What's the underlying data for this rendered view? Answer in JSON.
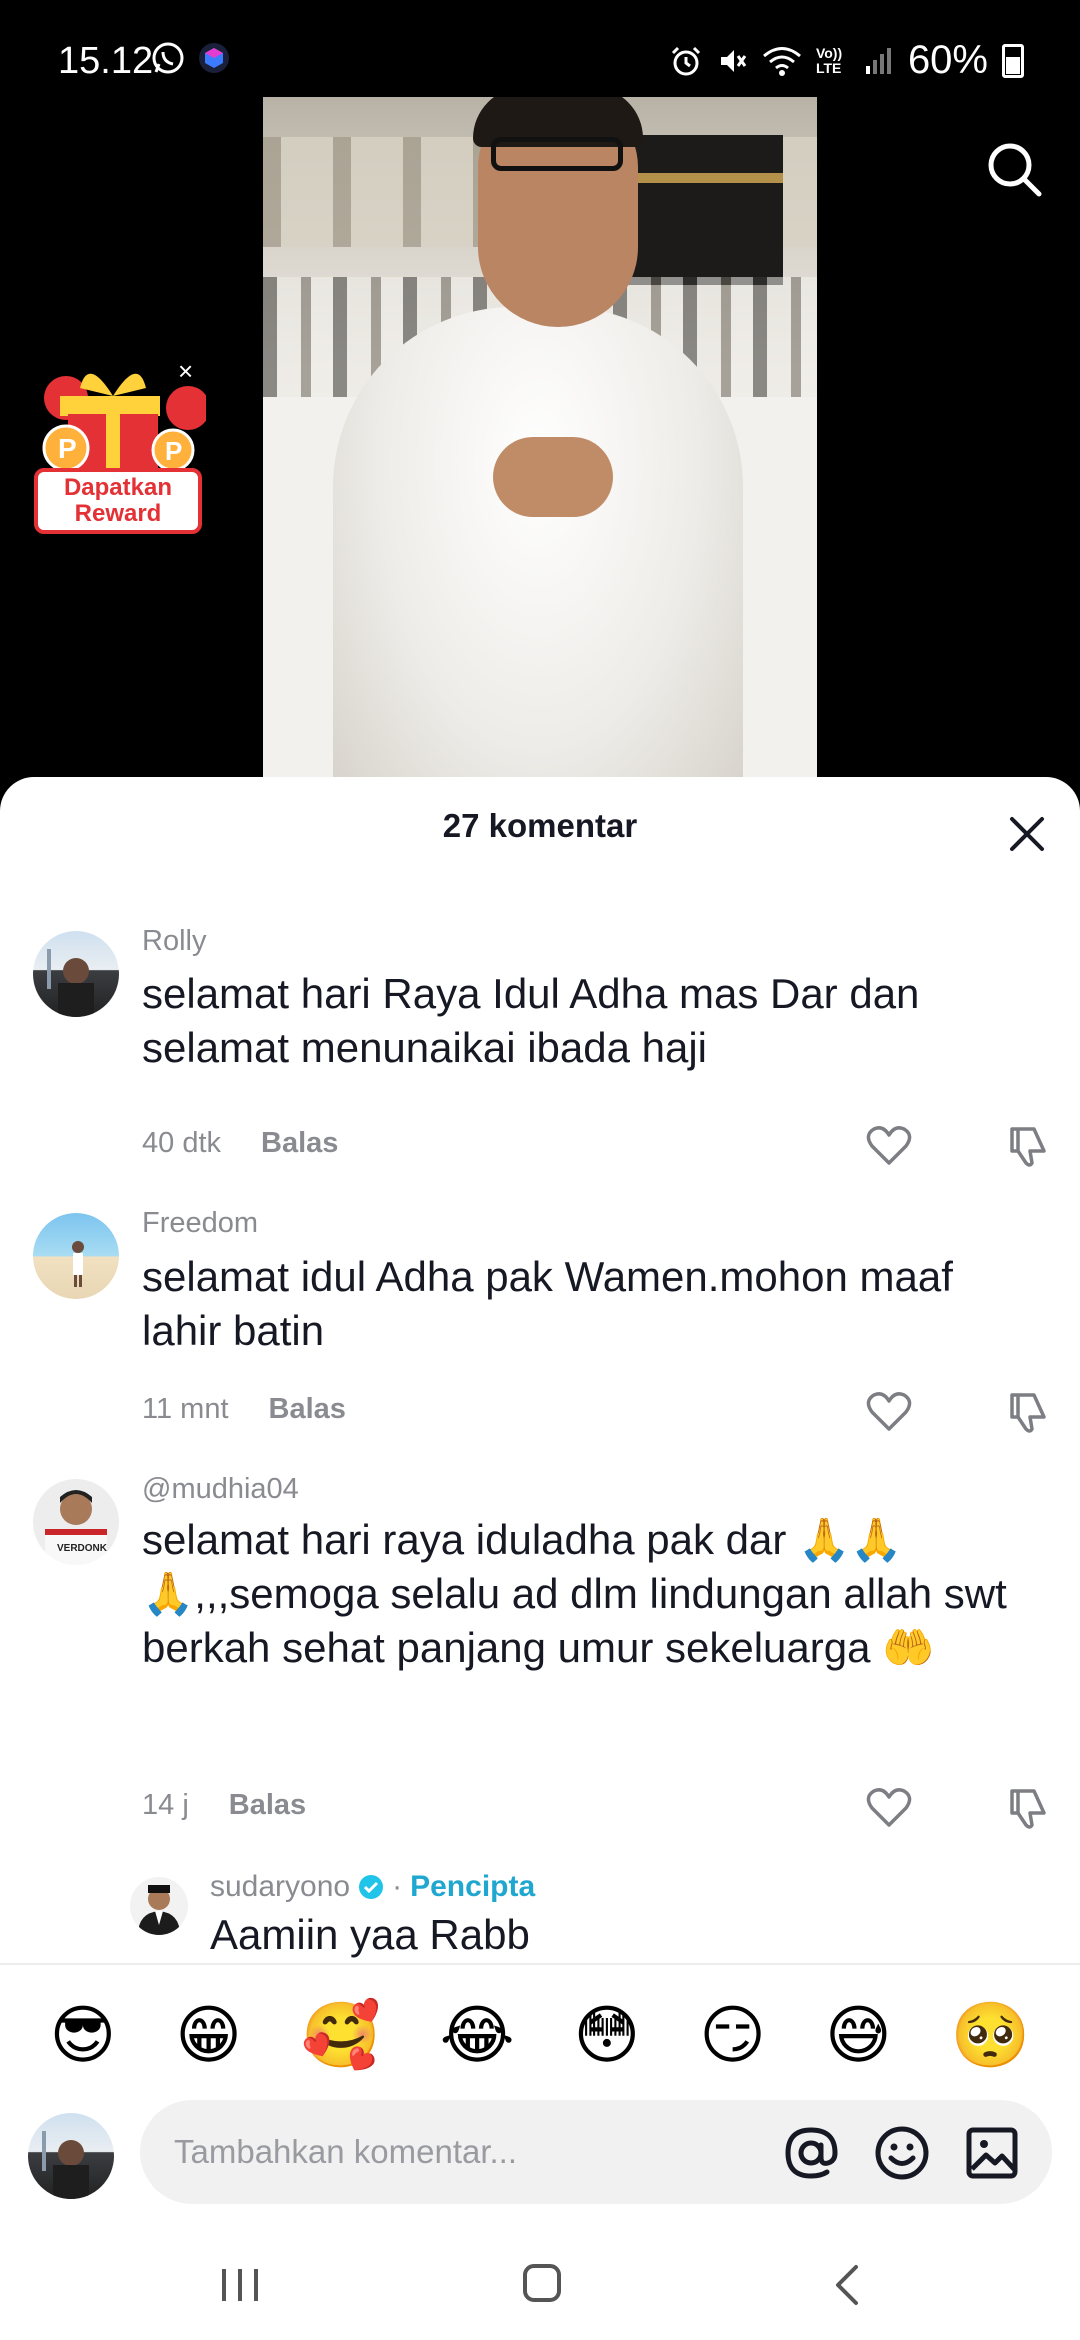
{
  "status_bar": {
    "time": "15.12",
    "battery": "60%",
    "left_icons": [
      "whatsapp-icon",
      "app-notification-icon"
    ],
    "right_icons": [
      "alarm-icon",
      "mute-icon",
      "wifi-icon",
      "volte-icon",
      "signal-icon",
      "battery-icon"
    ],
    "volte_label": "Vo)) LTE"
  },
  "video": {
    "search_icon": "search-icon"
  },
  "reward": {
    "label": "Dapatkan\nReward",
    "close": "×"
  },
  "sheet": {
    "title": "27 komentar",
    "close_icon": "close-icon"
  },
  "comments": [
    {
      "author": "Rolly",
      "text": "selamat hari Raya Idul Adha mas Dar dan selamat menunaikai ibada haji",
      "time": "40 dtk",
      "reply_label": "Balas"
    },
    {
      "author": "Freedom",
      "text": "selamat idul Adha pak Wamen.mohon maaf lahir batin",
      "time": "11 mnt",
      "reply_label": "Balas"
    },
    {
      "author": "@mudhia04",
      "text": "selamat hari raya iduladha pak dar 🙏🙏🙏,,,semoga selalu ad dlm lindungan allah swt berkah sehat panjang umur sekeluarga 🤲",
      "time": "14 j",
      "reply_label": "Balas",
      "avatar_text": "VERDONK"
    }
  ],
  "reply": {
    "author": "sudaryono",
    "separator": "·",
    "badge": "Pencipta",
    "text": "Aamiin yaa Rabb"
  },
  "emoji_bar": [
    "😎",
    "😁",
    "🥰",
    "😂",
    "😳",
    "😏",
    "😅",
    "🥺"
  ],
  "composer": {
    "placeholder": "Tambahkan komentar...",
    "icons": [
      "mention-icon",
      "emoji-picker-icon",
      "image-icon"
    ]
  },
  "nav_bar": {
    "icons": [
      "recent-apps-icon",
      "home-icon",
      "back-icon"
    ]
  },
  "colors": {
    "creator_badge": "#20a7d0",
    "reward_red": "#e43135",
    "text_primary": "#161823",
    "text_secondary": "#8a8b91"
  }
}
